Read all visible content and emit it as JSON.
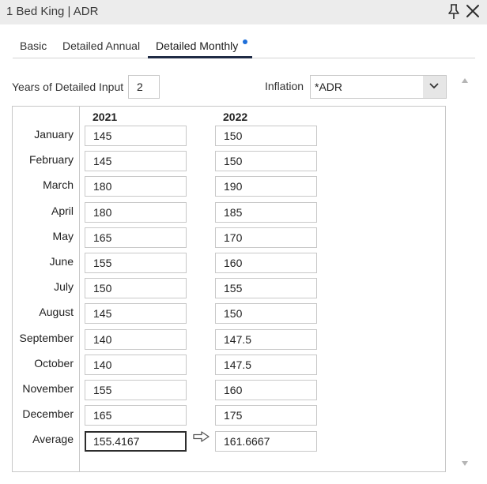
{
  "window": {
    "title": "1 Bed King | ADR"
  },
  "tabs": [
    {
      "label": "Basic"
    },
    {
      "label": "Detailed Annual"
    },
    {
      "label": "Detailed Monthly"
    }
  ],
  "years_input": {
    "label": "Years of Detailed Input",
    "value": "2"
  },
  "inflation": {
    "label": "Inflation",
    "value": "*ADR"
  },
  "grid": {
    "columns": [
      "2021",
      "2022"
    ],
    "rows": [
      {
        "month": "January",
        "values": [
          "145",
          "150"
        ]
      },
      {
        "month": "February",
        "values": [
          "145",
          "150"
        ]
      },
      {
        "month": "March",
        "values": [
          "180",
          "190"
        ]
      },
      {
        "month": "April",
        "values": [
          "180",
          "185"
        ]
      },
      {
        "month": "May",
        "values": [
          "165",
          "170"
        ]
      },
      {
        "month": "June",
        "values": [
          "155",
          "160"
        ]
      },
      {
        "month": "July",
        "values": [
          "150",
          "155"
        ]
      },
      {
        "month": "August",
        "values": [
          "145",
          "150"
        ]
      },
      {
        "month": "September",
        "values": [
          "140",
          "147.5"
        ]
      },
      {
        "month": "October",
        "values": [
          "140",
          "147.5"
        ]
      },
      {
        "month": "November",
        "values": [
          "155",
          "160"
        ]
      },
      {
        "month": "December",
        "values": [
          "165",
          "175"
        ]
      }
    ],
    "average": {
      "label": "Average",
      "values": [
        "155.4167",
        "161.6667"
      ]
    }
  },
  "colors": {
    "active_tab_underline": "#1f2b45",
    "tab_dot": "#1e6fd9",
    "titlebar_bg": "#ececec"
  }
}
